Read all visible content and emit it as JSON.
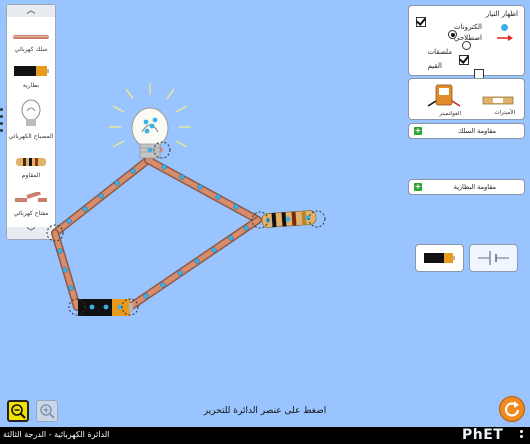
{
  "toolbox": {
    "scroll_up": "︿",
    "scroll_down": "﹀",
    "items": [
      {
        "label": "سلك كهربائي"
      },
      {
        "label": "بطارية"
      },
      {
        "label": "المصباح الكهربائي"
      },
      {
        "label": "المقاوم"
      },
      {
        "label": "مفتاح كهربائي"
      }
    ]
  },
  "panel": {
    "show_current": "اظهار التيار",
    "electrons": "الكترونات",
    "conventional": "اصطلاحي",
    "labels": "ملصقات",
    "values": "القيم",
    "voltmeter": "الفولتميتر",
    "ammeter": "الأميترات",
    "wire_resistivity": "مقاومة السلك",
    "battery_resistance": "مقاومة البطارية"
  },
  "hint": "اضغط على عنصر الدائرة للتحرير",
  "footer": {
    "title": "الدائرة الكهربائية - الدرجة الثالثة",
    "brand": "PhET"
  },
  "colors": {
    "background": "#99c4ff",
    "wire": "#d1876a",
    "electron": "#3ab0e8",
    "accent": "#f2e200"
  },
  "icons": [
    "zoom-out-icon",
    "zoom-in-icon",
    "reset-icon",
    "checkbox-icon",
    "radio-icon",
    "plus-icon"
  ]
}
